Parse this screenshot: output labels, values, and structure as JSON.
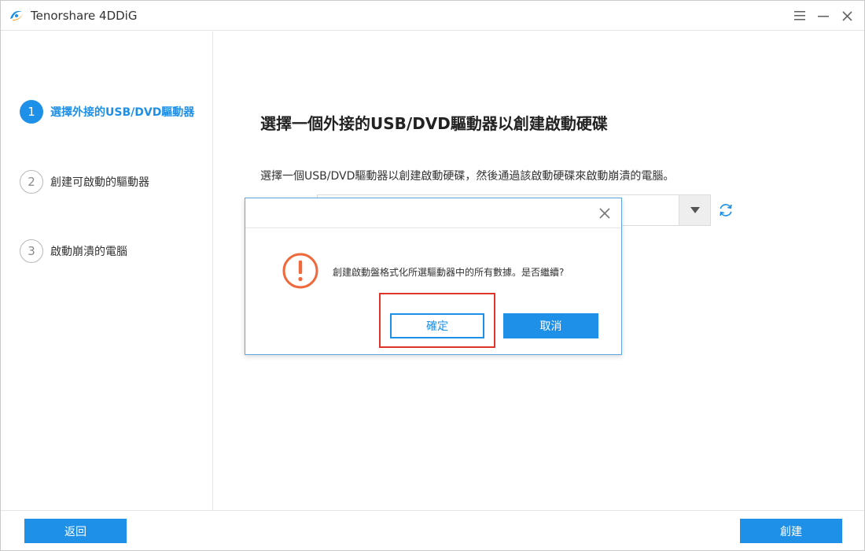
{
  "window": {
    "title": "Tenorshare 4DDiG",
    "icons": {
      "logo": "4ddig-logo-icon",
      "menu": "hamburger-menu-icon",
      "minimize": "minimize-icon",
      "close": "close-icon"
    }
  },
  "sidebar": {
    "steps": [
      {
        "number": "1",
        "label": "選擇外接的USB/DVD驅動器",
        "state": "active"
      },
      {
        "number": "2",
        "label": "創建可啟動的驅動器",
        "state": "inactive"
      },
      {
        "number": "3",
        "label": "啟動崩潰的電腦",
        "state": "inactive"
      }
    ]
  },
  "main": {
    "title": "選擇一個外接的USB/DVD驅動器以創建啟動硬碟",
    "description": "選擇一個USB/DVD驅動器以創建啟動硬碟，然後通過該啟動硬碟來啟動崩潰的電腦。",
    "drive_select": {
      "value": "",
      "icon": "dropdown-arrow-icon"
    },
    "refresh_icon": "refresh-icon"
  },
  "dialog": {
    "message": "創建啟動盤格式化所選驅動器中的所有數據。是否繼續?",
    "confirm_label": "確定",
    "cancel_label": "取消",
    "icons": {
      "warning": "warning-icon",
      "close": "close-icon"
    }
  },
  "footer": {
    "back_label": "返回",
    "create_label": "創建"
  },
  "colors": {
    "accent": "#1e90e8",
    "warning": "#f0693c",
    "highlight": "#e0352b"
  }
}
